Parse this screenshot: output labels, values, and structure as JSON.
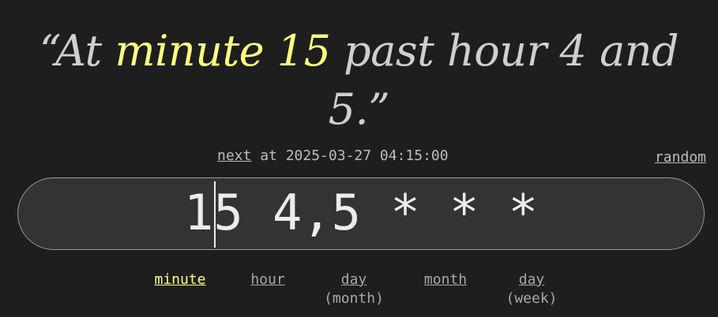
{
  "headline": {
    "prefix": "“At ",
    "highlight": "minute 15",
    "suffix": " past hour 4 and 5.”"
  },
  "next": {
    "link_label": "next",
    "text": " at 2025-03-27 04:15:00"
  },
  "random_label": "random",
  "cron": {
    "value": "15 4,5 * * *"
  },
  "parts": [
    {
      "label": "minute",
      "sub": ""
    },
    {
      "label": "hour",
      "sub": ""
    },
    {
      "label": "day",
      "sub": "(month)"
    },
    {
      "label": "month",
      "sub": ""
    },
    {
      "label": "day",
      "sub": "(week)"
    }
  ],
  "colors": {
    "background": "#1e1e1e",
    "highlight": "#ffff80",
    "input_bg": "#333333"
  }
}
